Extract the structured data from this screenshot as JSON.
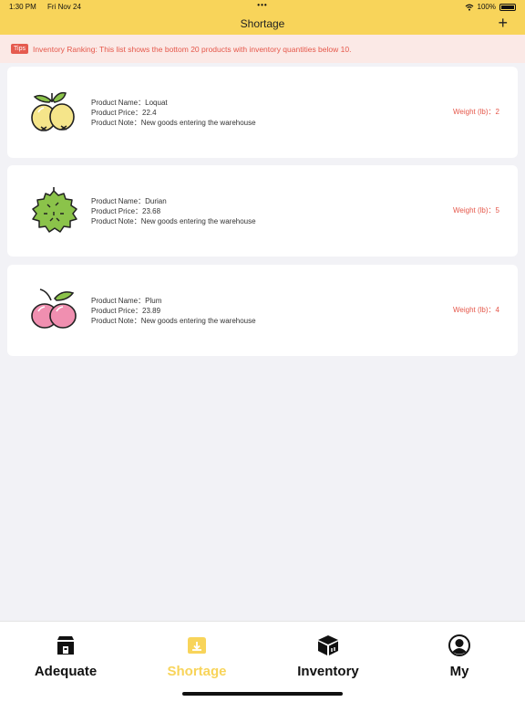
{
  "status_bar": {
    "time": "1:30 PM",
    "date": "Fri Nov 24",
    "dots": "•••",
    "battery": "100%"
  },
  "header": {
    "title": "Shortage",
    "add_icon": "plus-icon",
    "add_label": "+"
  },
  "tips": {
    "badge": "Tips",
    "text": "Inventory Ranking: This list shows the bottom 20 products with inventory quantities below 10."
  },
  "labels": {
    "name": "Product Name：",
    "price": "Product Price：",
    "note": "Product Note：",
    "weight": "Weight (lb)："
  },
  "products": [
    {
      "name": "Loquat",
      "price": "22.4",
      "note": "New goods entering the warehouse",
      "weight": "2",
      "icon": "loquat-icon"
    },
    {
      "name": "Durian",
      "price": "23.68",
      "note": "New goods entering the warehouse",
      "weight": "5",
      "icon": "durian-icon"
    },
    {
      "name": "Plum",
      "price": "23.89",
      "note": "New goods entering the warehouse",
      "weight": "4",
      "icon": "plum-icon"
    }
  ],
  "tabs": [
    {
      "label": "Adequate",
      "icon": "store-icon",
      "active": false
    },
    {
      "label": "Shortage",
      "icon": "inbox-download-icon",
      "active": true
    },
    {
      "label": "Inventory",
      "icon": "box-icon",
      "active": false
    },
    {
      "label": "My",
      "icon": "user-icon",
      "active": false
    }
  ],
  "colors": {
    "accent": "#f8d45a",
    "warning": "#e5574a",
    "tips_bg": "#fbe9e6",
    "background": "#f2f2f6"
  }
}
